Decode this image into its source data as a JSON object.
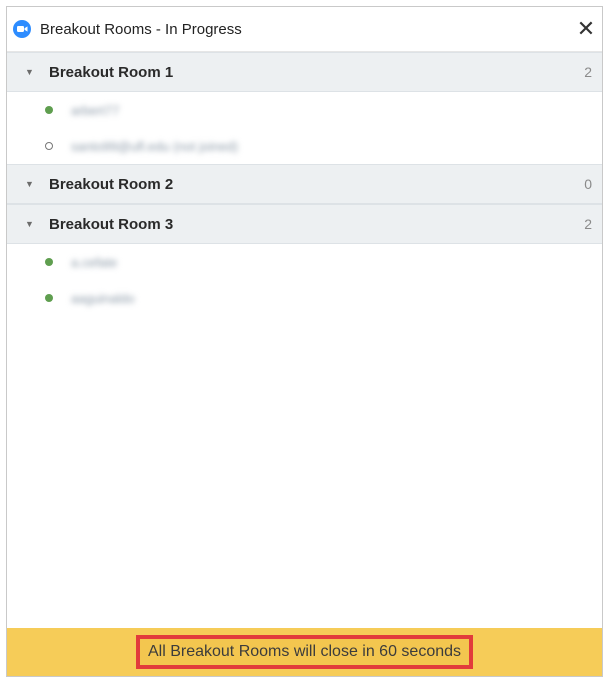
{
  "window": {
    "title": "Breakout Rooms - In Progress",
    "app_icon": "zoom-icon",
    "close_glyph": "✕"
  },
  "rooms": [
    {
      "name": "Breakout Room 1",
      "count": "2",
      "members": [
        {
          "name": "arbert77",
          "status": "joined"
        },
        {
          "name": "santo99@ufl.edu (not joined)",
          "status": "not-joined"
        }
      ]
    },
    {
      "name": "Breakout Room 2",
      "count": "0",
      "members": []
    },
    {
      "name": "Breakout Room 3",
      "count": "2",
      "members": [
        {
          "name": "a.cefate",
          "status": "joined"
        },
        {
          "name": "aaguinaldo",
          "status": "joined"
        }
      ]
    }
  ],
  "footer": {
    "message": "All Breakout Rooms will close in 60 seconds"
  },
  "colors": {
    "footer_bg": "#f6cc58",
    "highlight_border": "#e23b3b",
    "joined_dot": "#5f9e4f",
    "zoom_blue": "#2d8cff"
  }
}
